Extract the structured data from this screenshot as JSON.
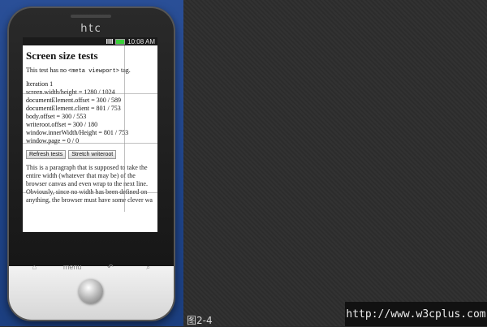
{
  "phone": {
    "brand": "htc",
    "status_time": "10:08 AM"
  },
  "page": {
    "title": "Screen size tests",
    "intro_prefix": "This test has no ",
    "intro_code": "<meta viewport>",
    "intro_suffix": " tag.",
    "iteration": "Iteration 1",
    "results": [
      "screen.width/height = 1280 / 1024",
      "documentElement.offset = 300 / 589",
      "documentElement.client = 801 / 753",
      "body.offset = 300 / 553",
      "writeroot.offset = 300 / 180",
      "window.innerWidth/Height = 801 / 753",
      "window.page = 0 / 0"
    ],
    "buttons": {
      "refresh": "Refresh tests",
      "stretch": "Stretch writeroot"
    },
    "paragraph": "This is a paragraph that is supposed to take the entire width (whatever that may be) of the browser canvas and even wrap to the next line. Obviously, since no width has been defined on anything, the browser must have some clever wa"
  },
  "nav": {
    "menu_label": "menu"
  },
  "caption": "图2-4",
  "watermark": "http://www.w3cplus.com"
}
